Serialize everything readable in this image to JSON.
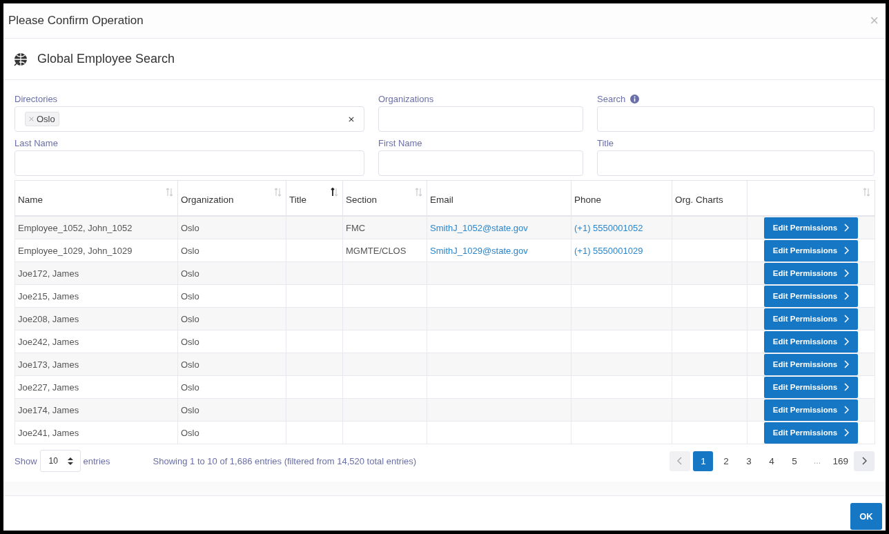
{
  "dialog": {
    "title": "Please Confirm Operation",
    "close": "×"
  },
  "section": {
    "title": "Global Employee Search"
  },
  "filters": [
    {
      "label": "Directories",
      "kind": "tags",
      "tags": [
        "Oslo"
      ],
      "info": false
    },
    {
      "label": "Organizations",
      "kind": "text",
      "info": false
    },
    {
      "label": "Search",
      "kind": "text",
      "info": true
    },
    {
      "label": "Last Name",
      "kind": "text",
      "info": false
    },
    {
      "label": "First Name",
      "kind": "text",
      "info": false
    },
    {
      "label": "Title",
      "kind": "text",
      "info": false
    }
  ],
  "table": {
    "columns": [
      {
        "label": "Name",
        "sortable": true,
        "sorted": false
      },
      {
        "label": "Organization",
        "sortable": true,
        "sorted": false
      },
      {
        "label": "Title",
        "sortable": true,
        "sorted": true
      },
      {
        "label": "Section",
        "sortable": true,
        "sorted": false
      },
      {
        "label": "Email",
        "sortable": false
      },
      {
        "label": "Phone",
        "sortable": false
      },
      {
        "label": "Org. Charts",
        "sortable": false
      },
      {
        "sortable": true,
        "sorted": false
      }
    ],
    "rows": [
      {
        "name": "Employee_1052, John_1052",
        "organization": "Oslo",
        "title": "",
        "section": "FMC",
        "email": "SmithJ_1052@state.gov",
        "phone": "(+1) 5550001052",
        "action": "Edit Permissions"
      },
      {
        "name": "Employee_1029, John_1029",
        "organization": "Oslo",
        "title": "",
        "section": "MGMTE/CLOS",
        "email": "SmithJ_1029@state.gov",
        "phone": "(+1) 5550001029",
        "action": "Edit Permissions"
      },
      {
        "name": "Joe172, James",
        "organization": "Oslo",
        "title": "",
        "section": "",
        "email": "",
        "phone": "",
        "action": "Edit Permissions"
      },
      {
        "name": "Joe215, James",
        "organization": "Oslo",
        "title": "",
        "section": "",
        "email": "",
        "phone": "",
        "action": "Edit Permissions"
      },
      {
        "name": "Joe208, James",
        "organization": "Oslo",
        "title": "",
        "section": "",
        "email": "",
        "phone": "",
        "action": "Edit Permissions"
      },
      {
        "name": "Joe242, James",
        "organization": "Oslo",
        "title": "",
        "section": "",
        "email": "",
        "phone": "",
        "action": "Edit Permissions"
      },
      {
        "name": "Joe173, James",
        "organization": "Oslo",
        "title": "",
        "section": "",
        "email": "",
        "phone": "",
        "action": "Edit Permissions"
      },
      {
        "name": "Joe227, James",
        "organization": "Oslo",
        "title": "",
        "section": "",
        "email": "",
        "phone": "",
        "action": "Edit Permissions"
      },
      {
        "name": "Joe174, James",
        "organization": "Oslo",
        "title": "",
        "section": "",
        "email": "",
        "phone": "",
        "action": "Edit Permissions"
      },
      {
        "name": "Joe241, James",
        "organization": "Oslo",
        "title": "",
        "section": "",
        "email": "",
        "phone": "",
        "action": "Edit Permissions"
      }
    ]
  },
  "footer": {
    "show_label": "Show",
    "page_size": "10",
    "entries_label": "entries",
    "info": "Showing 1 to 10 of 1,686 entries (filtered from 14,520 total entries)"
  },
  "pagination": {
    "previous_disabled": true,
    "next_disabled": false,
    "pages": [
      {
        "label": "1",
        "kind": "page",
        "selected": true
      },
      {
        "label": "2",
        "kind": "page",
        "selected": false
      },
      {
        "label": "3",
        "kind": "page",
        "selected": false
      },
      {
        "label": "4",
        "kind": "page",
        "selected": false
      },
      {
        "label": "5",
        "kind": "page",
        "selected": false
      },
      {
        "label": "…",
        "kind": "ellipsis",
        "selected": false
      },
      {
        "label": "169",
        "kind": "page",
        "selected": false
      }
    ]
  },
  "buttons": [
    "OK"
  ]
}
